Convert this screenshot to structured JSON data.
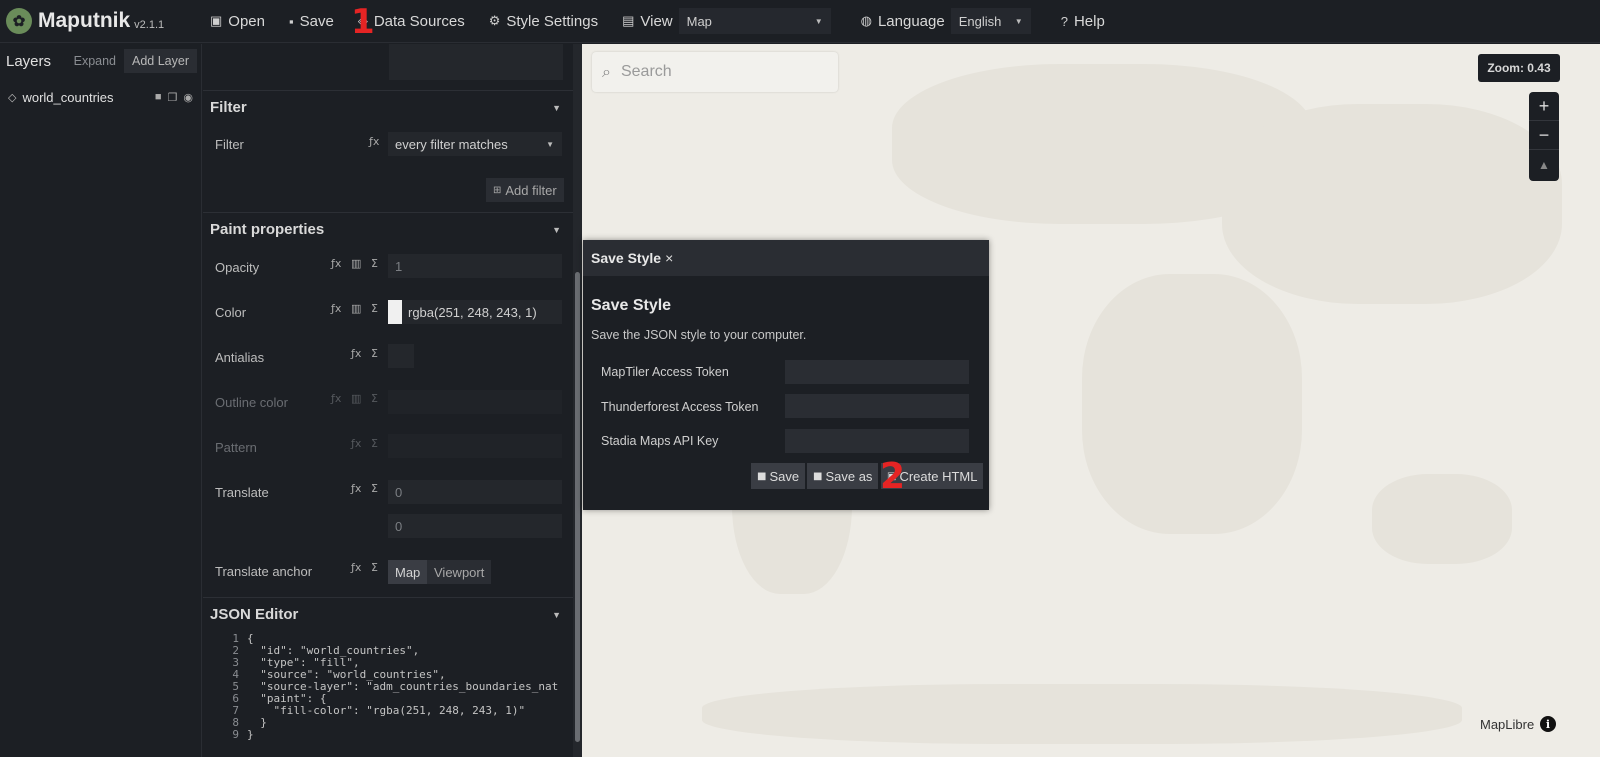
{
  "app": {
    "name": "Maputnik",
    "version": "v2.1.1"
  },
  "toolbar": {
    "open_label": "Open",
    "save_label": "Save",
    "data_sources_label": "Data Sources",
    "style_settings_label": "Style Settings",
    "view_label": "View",
    "view_value": "Map",
    "language_label": "Language",
    "language_value": "English",
    "help_label": "Help"
  },
  "annotations": {
    "first": "1",
    "second": "2",
    "color": "#e52424"
  },
  "layers_panel": {
    "title": "Layers",
    "expand_label": "Expand",
    "add_label": "Add Layer",
    "items": [
      {
        "name": "world_countries"
      }
    ]
  },
  "editor": {
    "filter_section": "Filter",
    "filter_label": "Filter",
    "filter_value": "every filter matches",
    "add_filter_label": "Add filter",
    "paint_section": "Paint properties",
    "opacity_label": "Opacity",
    "opacity_value": "1",
    "color_label": "Color",
    "color_value": "rgba(251, 248, 243, 1)",
    "antialias_label": "Antialias",
    "outline_color_label": "Outline color",
    "pattern_label": "Pattern",
    "translate_label": "Translate",
    "translate_x": "0",
    "translate_y": "0",
    "translate_anchor_label": "Translate anchor",
    "anchor_map": "Map",
    "anchor_viewport": "Viewport",
    "json_section": "JSON Editor",
    "json_lines": [
      "{",
      "  \"id\": \"world_countries\",",
      "  \"type\": \"fill\",",
      "  \"source\": \"world_countries\",",
      "  \"source-layer\": \"adm_countries_boundaries_nat",
      "  \"paint\": {",
      "    \"fill-color\": \"rgba(251, 248, 243, 1)\"",
      "  }",
      "}"
    ]
  },
  "map": {
    "search_placeholder": "Search",
    "zoom_label": "Zoom: 0.43",
    "attribution": "MapLibre"
  },
  "modal": {
    "header": "Save Style",
    "title": "Save Style",
    "description": "Save the JSON style to your computer.",
    "maptiler_label": "MapTiler Access Token",
    "thunderforest_label": "Thunderforest Access Token",
    "stadia_label": "Stadia Maps API Key",
    "save_btn": "Save",
    "save_as_btn": "Save as",
    "create_html_btn": "Create HTML"
  }
}
